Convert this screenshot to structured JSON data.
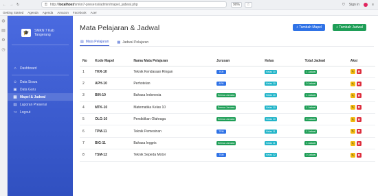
{
  "browser": {
    "url_prefix": "http://",
    "url_host": "localhost",
    "url_path": "/smkn7-presensi/admin/mapel_jadwal.php",
    "zoom": "90%",
    "bookmarks": [
      "Getting Started",
      "Agenda",
      "Agenda",
      "Amazon",
      "Facebook",
      "Acer"
    ],
    "sign_in": "Sign in"
  },
  "sidebar": {
    "brand_line1": "SMKN 7 Kab",
    "brand_line2": "Tangerang",
    "items": [
      {
        "label": "Dashboard",
        "icon": "home-icon",
        "glyph": "⌂"
      },
      {
        "label": "Data Siswa",
        "icon": "users-icon",
        "glyph": "☺"
      },
      {
        "label": "Data Guru",
        "icon": "teacher-icon",
        "glyph": "▣"
      },
      {
        "label": "Mapel & Jadwal",
        "icon": "book-icon",
        "glyph": "▤",
        "active": true
      },
      {
        "label": "Laporan Presensi",
        "icon": "report-icon",
        "glyph": "▥"
      },
      {
        "label": "Logout",
        "icon": "logout-icon",
        "glyph": "↪"
      }
    ]
  },
  "main": {
    "title": "Mata Pelajaran & Jadwal",
    "btn_mapel": "+ Tambah Mapel",
    "btn_jadwal": "+ Tambah Jadwal",
    "tabs": [
      {
        "label": "Mata Pelajaran",
        "active": true
      },
      {
        "label": "Jadwal Pelajaran",
        "active": false
      }
    ],
    "columns": [
      "No",
      "Kode Mapel",
      "Nama Mata Pelajaran",
      "Jurusan",
      "Kelas",
      "Total Jadwal",
      "Aksi"
    ],
    "rows": [
      {
        "no": "1",
        "kode": "TKR-10",
        "nama": "Teknik Kendaraan Ringan",
        "jurusan": "TKR",
        "jurusan_color": "blue",
        "kelas": "Kelas 10",
        "jadwal": "1 Jadwal"
      },
      {
        "no": "2",
        "kode": "APH-10",
        "nama": "Perhotelan",
        "jurusan": "APH",
        "jurusan_color": "blue",
        "kelas": "Kelas 10",
        "jadwal": "0 Jadwal"
      },
      {
        "no": "3",
        "kode": "BIN-10",
        "nama": "Bahasa Indonesia",
        "jurusan": "Semua Jurusan",
        "jurusan_color": "green",
        "kelas": "Kelas 10",
        "jadwal": "1 Jadwal"
      },
      {
        "no": "4",
        "kode": "MTK-10",
        "nama": "Matematika Kelas 10",
        "jurusan": "Semua Jurusan",
        "jurusan_color": "green",
        "kelas": "Kelas 10",
        "jadwal": "1 Jadwal"
      },
      {
        "no": "5",
        "kode": "OLG-10",
        "nama": "Pendidikan Olahraga",
        "jurusan": "Semua Jurusan",
        "jurusan_color": "green",
        "kelas": "Kelas 10",
        "jadwal": "0 Jadwal"
      },
      {
        "no": "6",
        "kode": "TPM-11",
        "nama": "Teknik Pemesinan",
        "jurusan": "TPM",
        "jurusan_color": "blue",
        "kelas": "Kelas 11",
        "jadwal": "1 Jadwal"
      },
      {
        "no": "7",
        "kode": "BIG-11",
        "nama": "Bahasa Inggris",
        "jurusan": "Semua Jurusan",
        "jurusan_color": "green",
        "kelas": "Kelas 11",
        "jadwal": "1 Jadwal"
      },
      {
        "no": "8",
        "kode": "TSM-12",
        "nama": "Teknik Sepeda Motor",
        "jurusan": "TSM",
        "jurusan_color": "blue",
        "kelas": "Kelas 12",
        "jadwal": "0 Jadwal"
      }
    ],
    "action_edit_icon": "edit-icon",
    "action_delete_icon": "trash-icon"
  }
}
